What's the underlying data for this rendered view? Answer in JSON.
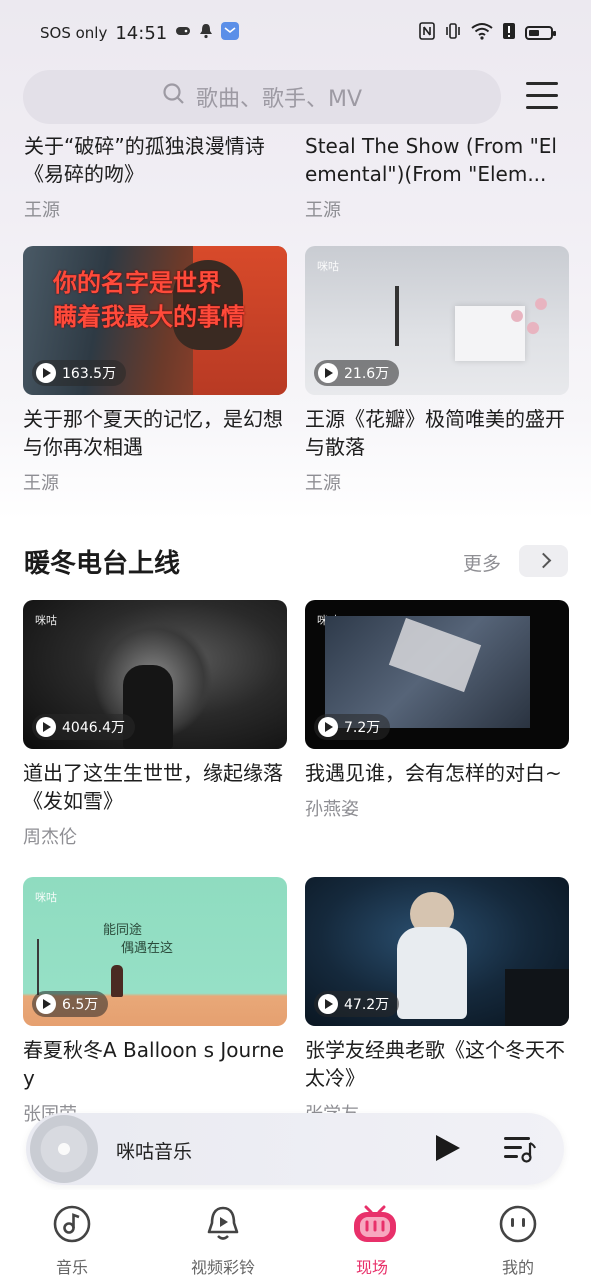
{
  "status_bar": {
    "carrier": "SOS only",
    "time": "14:51"
  },
  "search": {
    "placeholder": "歌曲、歌手、MV"
  },
  "top_cards": [
    {
      "title": "关于“破碎”的孤独浪漫情诗《易碎的吻》",
      "artist": "王源"
    },
    {
      "title": "Steal The Show (From \"Elemental\")(From \"Elem...",
      "artist": "王源"
    }
  ],
  "cards_row2": [
    {
      "title": "关于那个夏天的记忆，是幻想与你再次相遇",
      "artist": "王源",
      "plays": "163.5万"
    },
    {
      "title": "王源《花瓣》极简唯美的盛开与散落",
      "artist": "王源",
      "plays": "21.6万"
    }
  ],
  "section": {
    "title": "暖冬电台上线",
    "more": "更多"
  },
  "cards_row3": [
    {
      "title": "道出了这生生世世，缘起缘落《发如雪》",
      "artist": "周杰伦",
      "plays": "4046.4万"
    },
    {
      "title": "我遇见谁，会有怎样的对白~",
      "artist": "孙燕姿",
      "plays": "7.2万"
    }
  ],
  "cards_row4": [
    {
      "title": "春夏秋冬A Balloon s Journey",
      "artist": "张国荣",
      "plays": "6.5万"
    },
    {
      "title": "张学友经典老歌《这个冬天不太冷》",
      "artist": "张学友",
      "plays": "47.2万"
    }
  ],
  "thumb_text": {
    "logo": "咪咕",
    "row2_left": "你的名字是世界\n瞒着我最大的事情",
    "row4_left_a": "能同途",
    "row4_left_b": "偶遇在这"
  },
  "player": {
    "song": "咪咕音乐"
  },
  "tabs": [
    {
      "label": "音乐",
      "active": false
    },
    {
      "label": "视频彩铃",
      "active": false
    },
    {
      "label": "现场",
      "active": true
    },
    {
      "label": "我的",
      "active": false
    }
  ],
  "colors": {
    "accent": "#e8306a",
    "search_bg": "#e3e0e8"
  }
}
